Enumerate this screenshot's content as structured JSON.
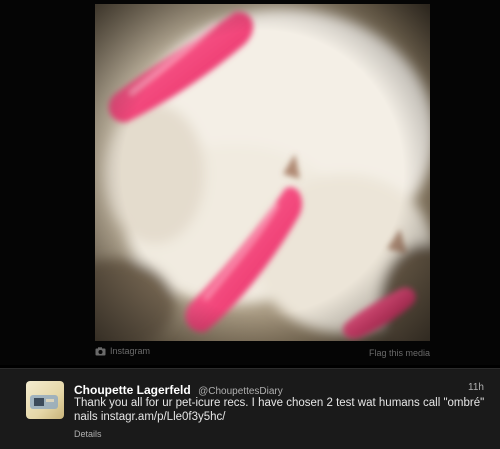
{
  "media": {
    "source_label": "Instagram",
    "flag_label": "Flag this media",
    "photo_icon": "camera-icon"
  },
  "tweet": {
    "display_name": "Choupette Lagerfeld",
    "screen_name": "@ChoupettesDiary",
    "time": "11h",
    "text": "Thank you all for ur pet-icure recs. I have chosen 2 test wat humans call \"ombré\" nails instagr.am/p/Lle0f3y5hc/",
    "details_label": "Details"
  },
  "colors": {
    "background": "#000000",
    "tweet_background": "#1a1a1a",
    "nail_pink": "#f2457a",
    "fur_white": "#f4efe6"
  }
}
